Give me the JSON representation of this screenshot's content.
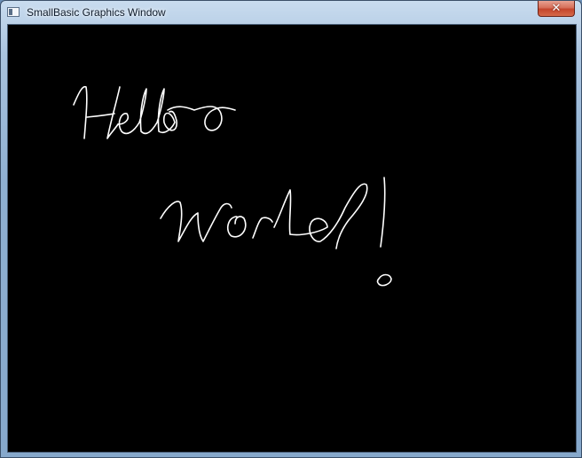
{
  "window": {
    "title": "SmallBasic Graphics Window",
    "close_symbol": "✕"
  },
  "icons": {
    "app": "graphics-window-app-icon",
    "close": "close-icon"
  },
  "canvas": {
    "background": "#000000",
    "stroke_color": "#ffffff",
    "drawing": "freehand handwriting"
  }
}
